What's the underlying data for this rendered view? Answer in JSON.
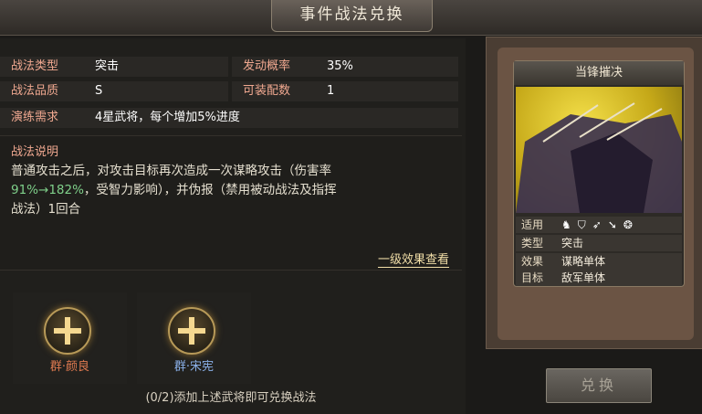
{
  "window": {
    "title": "事件战法兑换"
  },
  "info": {
    "type_label": "战法类型",
    "type_value": "突击",
    "rate_label": "发动概率",
    "rate_value": "35%",
    "quality_label": "战法品质",
    "quality_value": "S",
    "equip_label": "可装配数",
    "equip_value": "1",
    "req_label": "演练需求",
    "req_value": "4星武将，每个增加5%进度"
  },
  "description": {
    "title": "战法说明",
    "text_1": "普通攻击之后，对攻击目标再次造成一次谋略攻击（伤害率",
    "text_2_green": "91%→182%",
    "text_2": "，受智力影响），并伪报（禁用被动战法及指挥",
    "text_3": "战法）1回合"
  },
  "level_link": "一级效果查看",
  "slots": [
    {
      "label": "群·颜良",
      "color": "#e07a50"
    },
    {
      "label": "群·宋宪",
      "color": "#8ab0e8"
    }
  ],
  "bottom_note": "(0/2)添加上述武将即可兑换战法",
  "card": {
    "title": "当锋摧决",
    "suit_label": "适用",
    "suit_icons": [
      "horse-icon",
      "shield-icon",
      "bow-icon",
      "spear-icon",
      "wheel-icon"
    ],
    "type_label": "类型",
    "type_value": "突击",
    "effect_label": "效果",
    "effect_value": "谋略单体",
    "target_label": "目标",
    "target_value": "敌军单体"
  },
  "exchange_button": "兑换"
}
